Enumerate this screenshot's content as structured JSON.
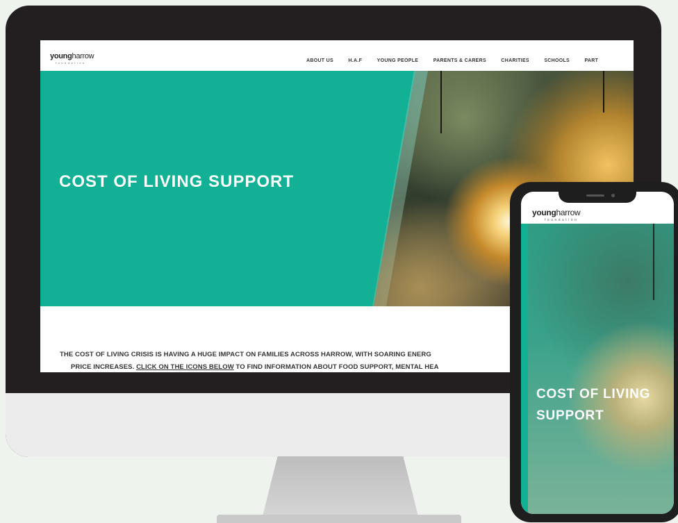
{
  "desktop": {
    "logo": {
      "young": "young",
      "harrow": "harrow",
      "foundation": "foundation"
    },
    "nav": [
      "ABOUT US",
      "H.A.F",
      "YOUNG PEOPLE",
      "PARENTS & CARERS",
      "CHARITIES",
      "SCHOOLS",
      "PART"
    ],
    "hero_title": "COST OF LIVING SUPPORT",
    "intro": {
      "line1": "THE COST OF LIVING CRISIS IS HAVING A HUGE IMPACT ON FAMILIES ACROSS HARROW, WITH SOARING ENERG",
      "line2_start": "PRICE INCREASES. ",
      "link": "CLICK ON THE ICONS BELOW",
      "line2_end": " TO FIND INFORMATION ABOUT FOOD SUPPORT, MENTAL HEA"
    }
  },
  "mobile": {
    "logo": {
      "young": "young",
      "harrow": "harrow",
      "foundation": "foundation"
    },
    "hero_title_line1": "COST OF LIVING",
    "hero_title_line2": "SUPPORT"
  },
  "colors": {
    "brand_teal": "#12b094",
    "bezel": "#231f20"
  }
}
